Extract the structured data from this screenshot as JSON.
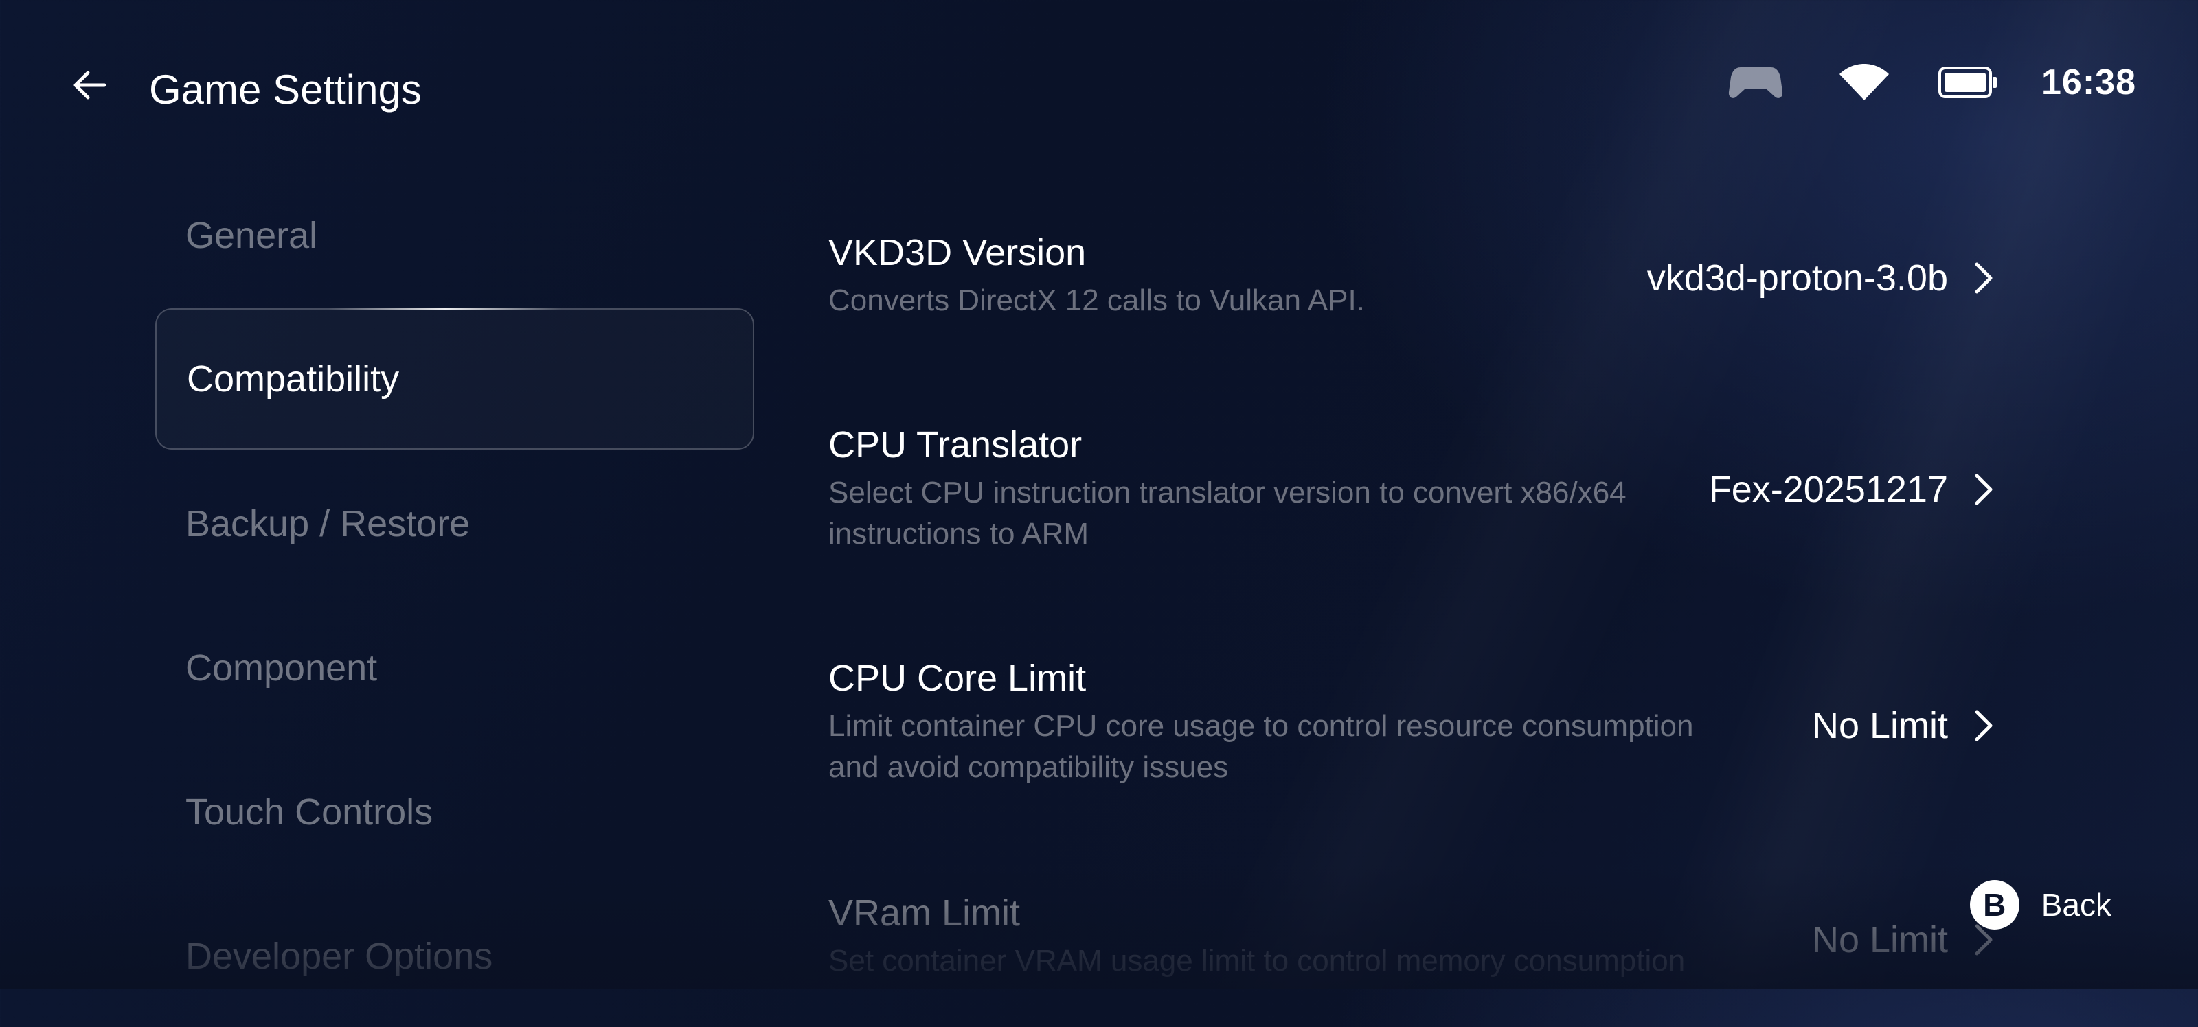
{
  "header": {
    "title": "Game Settings",
    "back_icon": "arrow-left-icon"
  },
  "status_bar": {
    "icons": [
      "gamepad-icon",
      "wifi-icon",
      "battery-icon"
    ],
    "time": "16:38"
  },
  "sidebar": {
    "items": [
      {
        "label": "General",
        "active": false
      },
      {
        "label": "Compatibility",
        "active": true
      },
      {
        "label": "Backup / Restore",
        "active": false
      },
      {
        "label": "Component",
        "active": false
      },
      {
        "label": "Touch Controls",
        "active": false
      },
      {
        "label": "Developer Options",
        "active": false
      }
    ]
  },
  "settings": [
    {
      "title": "VKD3D Version",
      "description": "Converts DirectX 12 calls to Vulkan API.",
      "value": "vkd3d-proton-3.0b"
    },
    {
      "title": "CPU Translator",
      "description_line1": "Select CPU instruction translator version to convert x86/x64",
      "description_line2": "instructions to ARM",
      "value": "Fex-20251217"
    },
    {
      "title": "CPU Core Limit",
      "description_line1": "Limit container CPU core usage to control resource consumption",
      "description_line2": "and avoid compatibility issues",
      "value": "No Limit"
    },
    {
      "title": "VRam Limit",
      "description": "Set container VRAM usage limit to control memory consumption",
      "value": "No Limit"
    }
  ],
  "back_hint": {
    "button": "B",
    "label": "Back"
  },
  "colors": {
    "background": "#0b132a",
    "text_primary": "#ffffff",
    "text_secondary": "#7a8092"
  }
}
